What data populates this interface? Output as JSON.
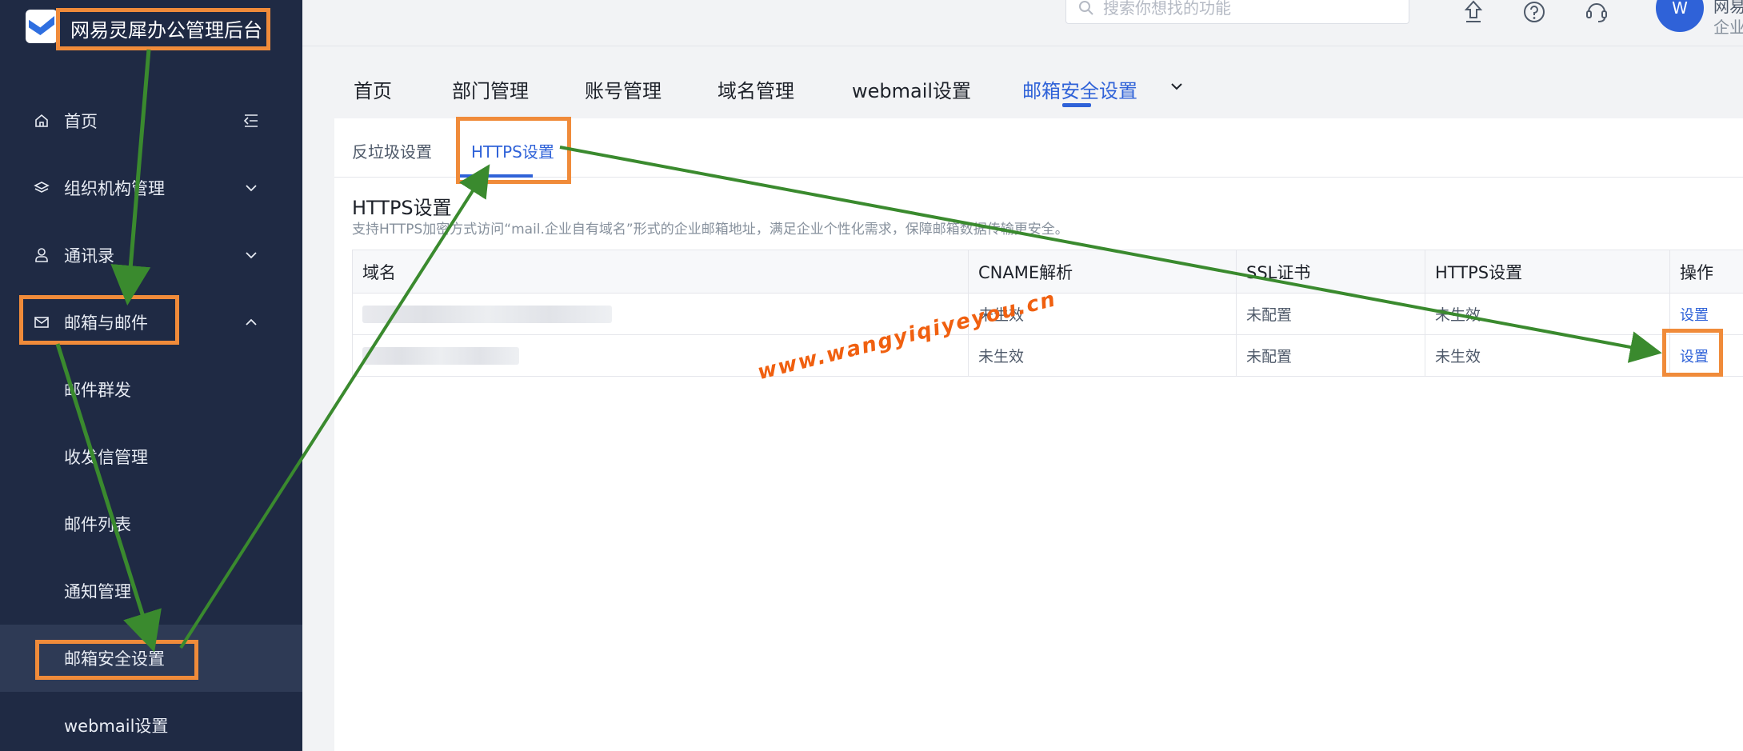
{
  "brand": {
    "title": "网易灵犀办公管理后台"
  },
  "sidebar": {
    "items": [
      {
        "label": "首页",
        "icon": "home-icon",
        "arrow": "collapse-menu-icon"
      },
      {
        "label": "组织机构管理",
        "icon": "layers-icon",
        "arrow": "chevron-down-icon"
      },
      {
        "label": "通讯录",
        "icon": "user-icon",
        "arrow": "chevron-down-icon"
      },
      {
        "label": "邮箱与邮件",
        "icon": "mail-icon",
        "arrow": "chevron-up-icon"
      }
    ],
    "subitems": [
      {
        "label": "邮件群发"
      },
      {
        "label": "收发信管理"
      },
      {
        "label": "邮件列表"
      },
      {
        "label": "通知管理"
      },
      {
        "label": "邮箱安全设置",
        "active": true
      },
      {
        "label": "webmail设置"
      }
    ]
  },
  "topbar": {
    "search_placeholder": "搜索你想找的功能",
    "icons": [
      "upload-icon",
      "help-icon",
      "support-icon"
    ],
    "avatar_letter": "W",
    "user_name": "网易",
    "user_org": "企业"
  },
  "top_tabs": [
    {
      "label": "首页"
    },
    {
      "label": "部门管理"
    },
    {
      "label": "账号管理"
    },
    {
      "label": "域名管理"
    },
    {
      "label": "webmail设置"
    },
    {
      "label": "邮箱安全设置",
      "active": true
    }
  ],
  "sub_tabs": [
    {
      "label": "反垃圾设置"
    },
    {
      "label": "HTTPS设置",
      "active": true
    }
  ],
  "section": {
    "title": "HTTPS设置",
    "description": "支持HTTPS加密方式访问“mail.企业自有域名”形式的企业邮箱地址，满足企业个性化需求，保障邮箱数据传输更安全。"
  },
  "table": {
    "headers": [
      "域名",
      "CNAME解析",
      "SSL证书",
      "HTTPS设置",
      "操作"
    ],
    "rows": [
      {
        "cname": "未生效",
        "ssl": "未配置",
        "https": "未生效",
        "action": "设置"
      },
      {
        "cname": "未生效",
        "ssl": "未配置",
        "https": "未生效",
        "action": "设置"
      }
    ]
  },
  "watermark": "www.wangyiqiyeyou.cn",
  "colors": {
    "sidebar_bg": "#1f2a44",
    "accent": "#2f62d8",
    "highlight_box": "#f08b3a",
    "arrow": "#3a8a2e",
    "watermark": "#f06010"
  }
}
